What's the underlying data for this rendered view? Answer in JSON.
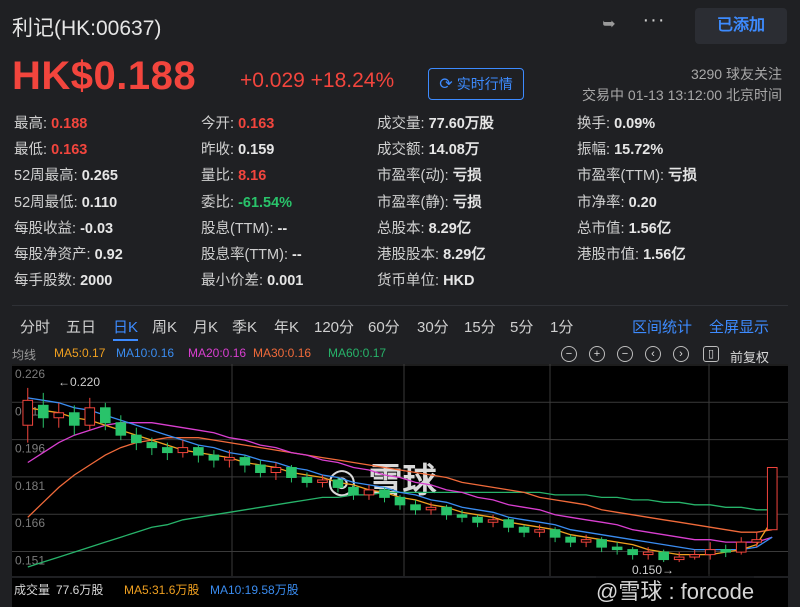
{
  "header": {
    "title": "利记(HK:00637)",
    "added_label": "已添加",
    "share_icon": "share-icon",
    "more_icon": "more-icon"
  },
  "quote": {
    "price": "HK$0.188",
    "change": "+0.029 +18.24%",
    "realtime_label": "实时行情",
    "followers": "3290 球友关注",
    "trade_status": "交易中 01-13 13:12:00 北京时间"
  },
  "stats": [
    {
      "label": "最高:",
      "value": "0.188",
      "color": "red"
    },
    {
      "label": "今开:",
      "value": "0.163",
      "color": "red"
    },
    {
      "label": "成交量:",
      "value": "77.60万股",
      "color": "white"
    },
    {
      "label": "换手:",
      "value": "0.09%",
      "color": "white"
    },
    {
      "label": "最低:",
      "value": "0.163",
      "color": "red"
    },
    {
      "label": "昨收:",
      "value": "0.159",
      "color": "white"
    },
    {
      "label": "成交额:",
      "value": "14.08万",
      "color": "white"
    },
    {
      "label": "振幅:",
      "value": "15.72%",
      "color": "white"
    },
    {
      "label": "52周最高:",
      "value": "0.265",
      "color": "white"
    },
    {
      "label": "量比:",
      "value": "8.16",
      "color": "red"
    },
    {
      "label": "市盈率(动):",
      "value": "亏损",
      "color": "white"
    },
    {
      "label": "市盈率(TTM):",
      "value": "亏损",
      "color": "white"
    },
    {
      "label": "52周最低:",
      "value": "0.110",
      "color": "white"
    },
    {
      "label": "委比:",
      "value": "-61.54%",
      "color": "green"
    },
    {
      "label": "市盈率(静):",
      "value": "亏损",
      "color": "white"
    },
    {
      "label": "市净率:",
      "value": "0.20",
      "color": "white"
    },
    {
      "label": "每股收益:",
      "value": "-0.03",
      "color": "white"
    },
    {
      "label": "股息(TTM):",
      "value": "--",
      "color": "white"
    },
    {
      "label": "总股本:",
      "value": "8.29亿",
      "color": "white"
    },
    {
      "label": "总市值:",
      "value": "1.56亿",
      "color": "white"
    },
    {
      "label": "每股净资产:",
      "value": "0.92",
      "color": "white"
    },
    {
      "label": "股息率(TTM):",
      "value": "--",
      "color": "white"
    },
    {
      "label": "港股股本:",
      "value": "8.29亿",
      "color": "white"
    },
    {
      "label": "港股市值:",
      "value": "1.56亿",
      "color": "white"
    },
    {
      "label": "每手股数:",
      "value": "2000",
      "color": "white"
    },
    {
      "label": "最小价差:",
      "value": "0.001",
      "color": "white"
    },
    {
      "label": "货币单位:",
      "value": "HKD",
      "color": "white"
    }
  ],
  "tabs": [
    "分时",
    "五日",
    "日K",
    "周K",
    "月K",
    "季K",
    "年K",
    "120分",
    "60分",
    "30分",
    "15分",
    "5分",
    "1分"
  ],
  "active_tab": "日K",
  "tab_links": {
    "range": "区间统计",
    "fullscreen": "全屏显示"
  },
  "ma": {
    "label": "均线",
    "items": [
      {
        "text": "MA5:0.17",
        "color": "#f0a020"
      },
      {
        "text": "MA10:0.16",
        "color": "#3a8cf0"
      },
      {
        "text": "MA20:0.16",
        "color": "#d93fd0"
      },
      {
        "text": "MA30:0.16",
        "color": "#f06a3a"
      },
      {
        "text": "MA60:0.17",
        "color": "#27b36a"
      }
    ],
    "fuquan": "前复权"
  },
  "chart_data": {
    "type": "candlestick",
    "y_ticks": [
      "0.226",
      "0.211",
      "0.196",
      "0.181",
      "0.166",
      "0.151"
    ],
    "high_label": "0.220",
    "low_label": "0.150",
    "candles": [
      [
        0.205,
        0.215,
        0.22,
        0.198
      ],
      [
        0.213,
        0.208,
        0.218,
        0.204
      ],
      [
        0.208,
        0.21,
        0.214,
        0.204
      ],
      [
        0.21,
        0.205,
        0.213,
        0.201
      ],
      [
        0.205,
        0.212,
        0.216,
        0.203
      ],
      [
        0.212,
        0.206,
        0.214,
        0.203
      ],
      [
        0.206,
        0.201,
        0.209,
        0.199
      ],
      [
        0.201,
        0.198,
        0.204,
        0.195
      ],
      [
        0.198,
        0.196,
        0.2,
        0.193
      ],
      [
        0.196,
        0.194,
        0.198,
        0.191
      ],
      [
        0.194,
        0.196,
        0.199,
        0.192
      ],
      [
        0.196,
        0.193,
        0.197,
        0.19
      ],
      [
        0.193,
        0.191,
        0.195,
        0.188
      ],
      [
        0.191,
        0.192,
        0.195,
        0.188
      ],
      [
        0.192,
        0.189,
        0.193,
        0.186
      ],
      [
        0.189,
        0.186,
        0.191,
        0.184
      ],
      [
        0.186,
        0.188,
        0.19,
        0.183
      ],
      [
        0.188,
        0.184,
        0.189,
        0.182
      ],
      [
        0.184,
        0.182,
        0.186,
        0.18
      ],
      [
        0.182,
        0.183,
        0.185,
        0.18
      ],
      [
        0.183,
        0.18,
        0.184,
        0.178
      ],
      [
        0.18,
        0.177,
        0.181,
        0.175
      ],
      [
        0.177,
        0.179,
        0.181,
        0.175
      ],
      [
        0.179,
        0.176,
        0.18,
        0.174
      ],
      [
        0.176,
        0.173,
        0.177,
        0.171
      ],
      [
        0.173,
        0.171,
        0.175,
        0.169
      ],
      [
        0.171,
        0.172,
        0.174,
        0.169
      ],
      [
        0.172,
        0.169,
        0.173,
        0.167
      ],
      [
        0.169,
        0.168,
        0.171,
        0.166
      ],
      [
        0.168,
        0.166,
        0.169,
        0.164
      ],
      [
        0.166,
        0.167,
        0.169,
        0.164
      ],
      [
        0.167,
        0.164,
        0.168,
        0.162
      ],
      [
        0.164,
        0.162,
        0.165,
        0.16
      ],
      [
        0.162,
        0.163,
        0.165,
        0.16
      ],
      [
        0.163,
        0.16,
        0.164,
        0.158
      ],
      [
        0.16,
        0.158,
        0.161,
        0.156
      ],
      [
        0.158,
        0.159,
        0.161,
        0.156
      ],
      [
        0.159,
        0.156,
        0.16,
        0.154
      ],
      [
        0.156,
        0.155,
        0.158,
        0.153
      ],
      [
        0.155,
        0.153,
        0.156,
        0.151
      ],
      [
        0.153,
        0.154,
        0.156,
        0.151
      ],
      [
        0.154,
        0.151,
        0.155,
        0.15
      ],
      [
        0.151,
        0.152,
        0.154,
        0.15
      ],
      [
        0.152,
        0.153,
        0.155,
        0.151
      ],
      [
        0.153,
        0.155,
        0.158,
        0.151
      ],
      [
        0.155,
        0.154,
        0.157,
        0.152
      ],
      [
        0.154,
        0.158,
        0.16,
        0.153
      ],
      [
        0.158,
        0.159,
        0.162,
        0.156
      ],
      [
        0.163,
        0.188,
        0.188,
        0.163
      ]
    ],
    "ma5": [
      0.212,
      0.211,
      0.21,
      0.208,
      0.207,
      0.205,
      0.203,
      0.201,
      0.199,
      0.197,
      0.195,
      0.194,
      0.193,
      0.192,
      0.19,
      0.189,
      0.188,
      0.186,
      0.185,
      0.184,
      0.182,
      0.181,
      0.179,
      0.178,
      0.176,
      0.175,
      0.173,
      0.172,
      0.17,
      0.169,
      0.168,
      0.166,
      0.165,
      0.164,
      0.163,
      0.161,
      0.16,
      0.159,
      0.158,
      0.157,
      0.155,
      0.154,
      0.153,
      0.153,
      0.153,
      0.154,
      0.155,
      0.157,
      0.167
    ],
    "ma10": [
      0.216,
      0.215,
      0.214,
      0.212,
      0.211,
      0.209,
      0.207,
      0.205,
      0.203,
      0.201,
      0.199,
      0.197,
      0.196,
      0.194,
      0.193,
      0.191,
      0.19,
      0.188,
      0.187,
      0.185,
      0.184,
      0.182,
      0.181,
      0.18,
      0.178,
      0.177,
      0.175,
      0.174,
      0.172,
      0.171,
      0.17,
      0.168,
      0.167,
      0.166,
      0.165,
      0.163,
      0.162,
      0.161,
      0.16,
      0.159,
      0.158,
      0.157,
      0.156,
      0.155,
      0.155,
      0.155,
      0.155,
      0.156,
      0.16
    ],
    "ma20": [
      0.19,
      0.194,
      0.198,
      0.201,
      0.203,
      0.205,
      0.206,
      0.206,
      0.206,
      0.205,
      0.204,
      0.203,
      0.202,
      0.2,
      0.199,
      0.197,
      0.196,
      0.194,
      0.193,
      0.191,
      0.19,
      0.188,
      0.187,
      0.185,
      0.184,
      0.182,
      0.181,
      0.179,
      0.178,
      0.176,
      0.175,
      0.173,
      0.172,
      0.171,
      0.169,
      0.168,
      0.167,
      0.166,
      0.165,
      0.163,
      0.162,
      0.161,
      0.16,
      0.159,
      0.159,
      0.158,
      0.158,
      0.158,
      0.16
    ],
    "ma30": [
      0.168,
      0.174,
      0.18,
      0.185,
      0.189,
      0.193,
      0.196,
      0.198,
      0.199,
      0.2,
      0.2,
      0.2,
      0.199,
      0.198,
      0.197,
      0.196,
      0.195,
      0.194,
      0.193,
      0.192,
      0.191,
      0.19,
      0.189,
      0.188,
      0.187,
      0.186,
      0.185,
      0.184,
      0.182,
      0.181,
      0.18,
      0.179,
      0.178,
      0.176,
      0.175,
      0.174,
      0.173,
      0.171,
      0.17,
      0.169,
      0.168,
      0.167,
      0.166,
      0.165,
      0.164,
      0.163,
      0.162,
      0.162,
      0.163
    ],
    "ma60": [
      0.148,
      0.15,
      0.152,
      0.154,
      0.156,
      0.158,
      0.16,
      0.162,
      0.164,
      0.165,
      0.167,
      0.168,
      0.169,
      0.17,
      0.171,
      0.172,
      0.173,
      0.174,
      0.175,
      0.176,
      0.176,
      0.177,
      0.177,
      0.178,
      0.178,
      0.178,
      0.178,
      0.178,
      0.178,
      0.178,
      0.178,
      0.178,
      0.178,
      0.178,
      0.177,
      0.177,
      0.177,
      0.176,
      0.176,
      0.175,
      0.175,
      0.174,
      0.174,
      0.173,
      0.173,
      0.172,
      0.172,
      0.171,
      0.171
    ],
    "y_min": 0.146,
    "y_max": 0.228
  },
  "volume": {
    "label": "成交量",
    "value": "77.6万股",
    "ma5": "MA5:31.6万股",
    "ma10": "MA10:19.58万股"
  },
  "watermark": "雪球",
  "footer_watermark": "@雪球 : forcode",
  "colors": {
    "up": "#f2453d",
    "down": "#29c36a",
    "accent": "#3d8bff"
  }
}
